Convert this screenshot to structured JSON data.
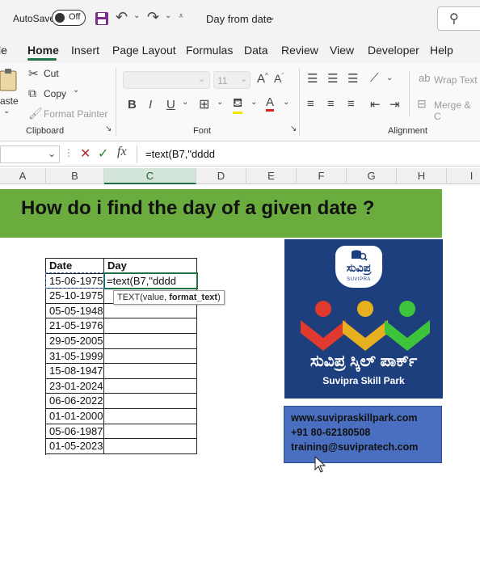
{
  "titlebar": {
    "autosave_label": "AutoSave",
    "autosave_state": "Off",
    "doc_title": "Day from date"
  },
  "tabs": [
    "File",
    "Home",
    "Insert",
    "Page Layout",
    "Formulas",
    "Data",
    "Review",
    "View",
    "Developer",
    "Help"
  ],
  "tabs_visible": [
    "le",
    "Home",
    "Insert",
    "Page Layout",
    "Formulas",
    "Data",
    "Review",
    "View",
    "Developer",
    "Help"
  ],
  "active_tab": "Home",
  "ribbon": {
    "paste": "aste",
    "cut": "Cut",
    "copy": "Copy",
    "format_painter": "Format Painter",
    "clipboard_group": "Clipboard",
    "font_size": "11",
    "font_group": "Font",
    "wrap_text": "Wrap Text",
    "merge_center": "Merge & C",
    "alignment_group": "Alignment"
  },
  "formula_bar": {
    "formula": "=text(B7,\"dddd"
  },
  "columns": [
    "A",
    "B",
    "C",
    "D",
    "E",
    "F",
    "G",
    "H",
    "I"
  ],
  "sheet": {
    "banner": "How do i find the day of a given date ?",
    "header_date": "Date",
    "header_day": "Day",
    "dates": [
      "15-06-1975",
      "25-10-1975",
      "05-05-1948",
      "21-05-1976",
      "29-05-2005",
      "31-05-1999",
      "15-08-1947",
      "23-01-2024",
      "06-06-2022",
      "01-01-2000",
      "05-06-1987",
      "01-05-2023"
    ],
    "editing_cell": "=text(B7,\"dddd",
    "tooltip_fn": "TEXT(value, ",
    "tooltip_arg": "format_text",
    "tooltip_close": ")"
  },
  "logo": {
    "badge_text": "ಸುವಿಪ್ರ",
    "badge_sub": "SUVIPRA",
    "kannada_title": "ಸುವಿಪ್ರ ಸ್ಕಿಲ್ ಪಾರ್ಕ್",
    "english_title": "Suvipra Skill Park"
  },
  "contact": {
    "website": "www.suvipraskillpark.com",
    "phone": "+91 80-62180508",
    "email": "training@suvipratech.com"
  },
  "colors": {
    "banner_green": "#6aac3d",
    "logo_navy": "#1d3f7e",
    "contact_blue": "#4a6fc0",
    "person_red": "#e03a2f",
    "person_yellow": "#e6b020",
    "person_green": "#3ec43a"
  }
}
